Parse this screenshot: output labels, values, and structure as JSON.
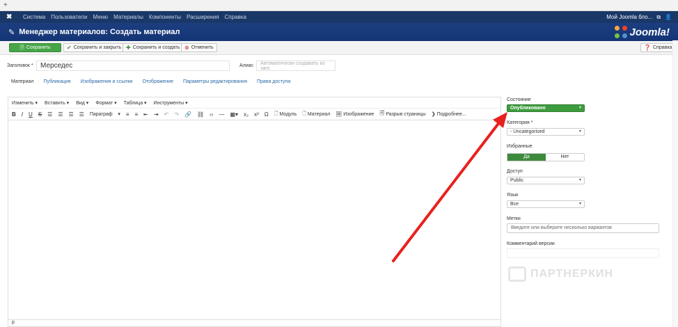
{
  "browser": {
    "plus": "+"
  },
  "topnav": {
    "items": [
      "Система",
      "Пользователи",
      "Меню",
      "Материалы",
      "Компоненты",
      "Расширения",
      "Справка"
    ],
    "site_name": "Мой Joomla бло...",
    "ext_icon": "external-link-icon",
    "user_icon": "user-icon"
  },
  "header": {
    "title": "Менеджер материалов: Создать материал",
    "logo_text": "Joomla!"
  },
  "toolbar": {
    "save": "Сохранить",
    "save_close": "Сохранить и закрыть",
    "save_new": "Сохранить и создать",
    "cancel": "Отменить",
    "help": "Справка"
  },
  "form": {
    "title_label": "Заголовок *",
    "title_value": "Мерседес",
    "alias_label": "Алиас",
    "alias_placeholder": "Автоматически создавать из заго"
  },
  "tabs": [
    "Материал",
    "Публикация",
    "Изображения и ссылки",
    "Отображение",
    "Параметры редактирования",
    "Права доступа"
  ],
  "editor": {
    "menu": [
      "Изменить ▾",
      "Вставить ▾",
      "Вид ▾",
      "Формат ▾",
      "Таблица ▾",
      "Инструменты ▾"
    ],
    "paragraph": "Параграф",
    "module": "Модуль",
    "article": "Материал",
    "image": "Изображение",
    "pagebreak": "Разрыв страницы",
    "readmore": "Подробнее...",
    "status_path": "p"
  },
  "sidebar": {
    "state_label": "Состояние",
    "state_value": "Опубликовано",
    "category_label": "Категория *",
    "category_value": "- Uncategorised",
    "featured_label": "Избранные",
    "featured_yes": "Да",
    "featured_no": "Нет",
    "access_label": "Доступ",
    "access_value": "Public",
    "language_label": "Язык",
    "language_value": "Все",
    "tags_label": "Метки",
    "tags_placeholder": "Введите или выберите несколько вариантов",
    "version_label": "Комментарий версии"
  },
  "watermark": "ПАРТНЕРКИН",
  "colors": {
    "nav": "#1a3867",
    "header": "#143575",
    "green": "#46a546",
    "arrow": "#e8211d",
    "link": "#2b6aa7"
  }
}
